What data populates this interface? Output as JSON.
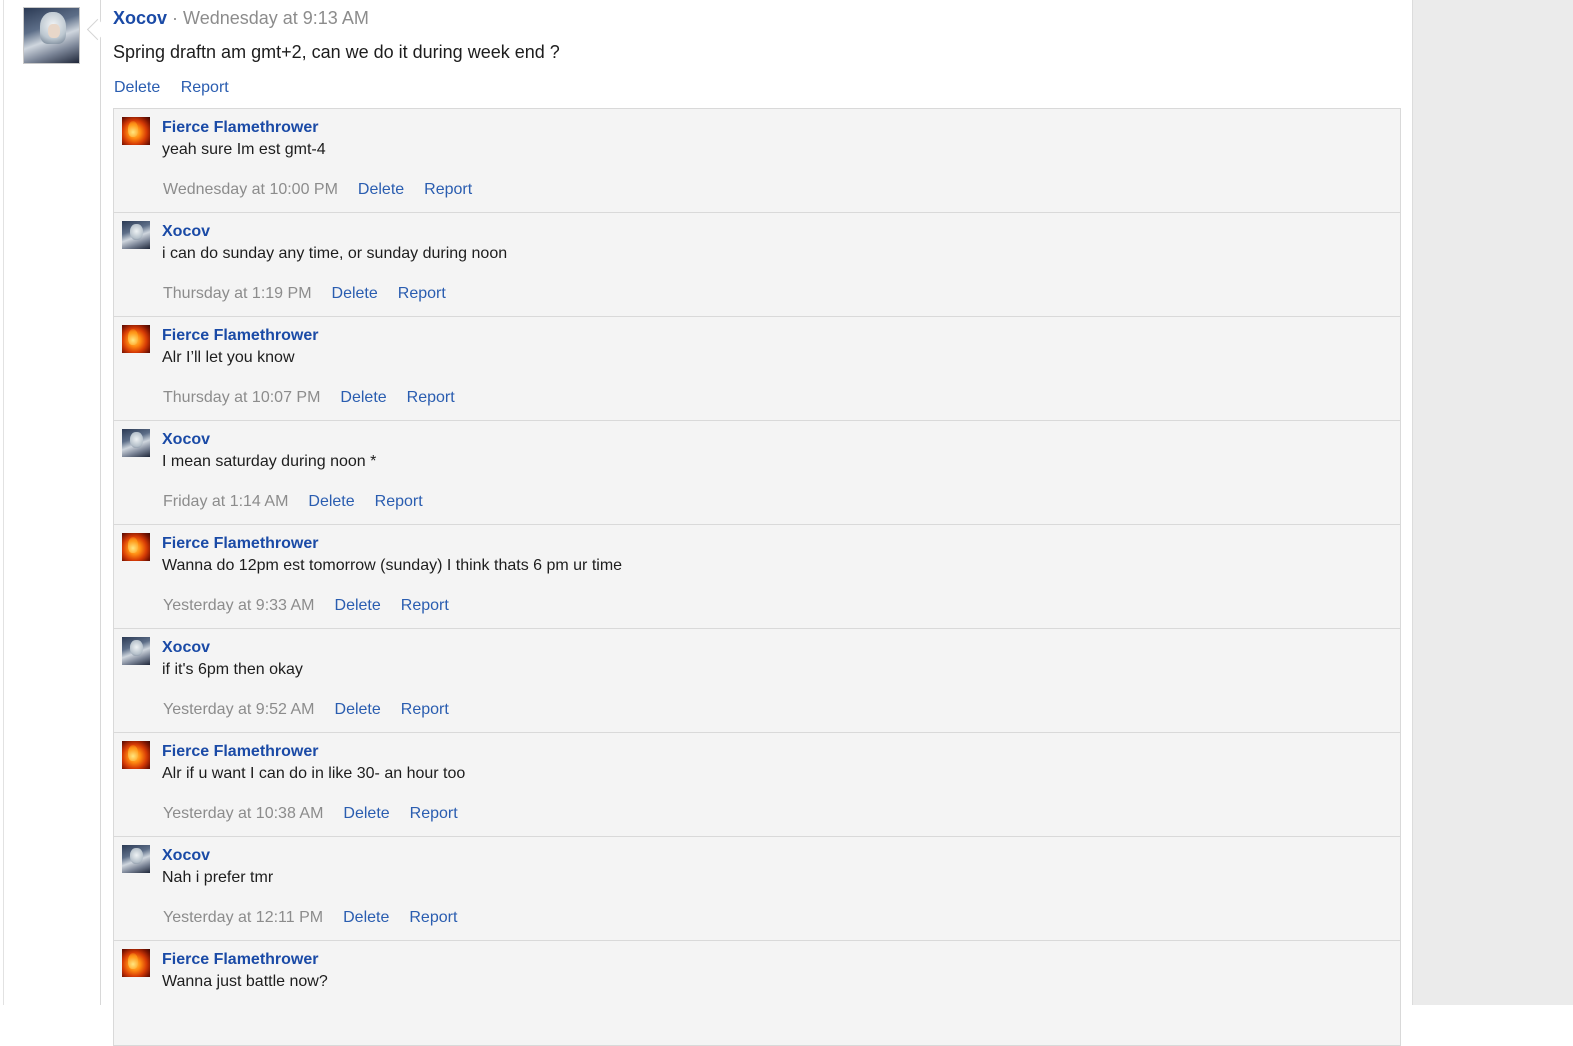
{
  "post": {
    "author": "Xocov",
    "separator": " · ",
    "time": "Wednesday at 9:13 AM",
    "text": "Spring draftn am gmt+2, can we do it during week end ?",
    "delete_label": "Delete",
    "report_label": "Report"
  },
  "comments": [
    {
      "author": "Fierce Flamethrower",
      "avatar": "fire-avatar",
      "text": "yeah sure Im est gmt-4",
      "time": "Wednesday at 10:00 PM",
      "delete_label": "Delete",
      "report_label": "Report"
    },
    {
      "author": "Xocov",
      "avatar": "xocov-avatar",
      "text": "i can do sunday any time, or sunday during noon",
      "time": "Thursday at 1:19 PM",
      "delete_label": "Delete",
      "report_label": "Report"
    },
    {
      "author": "Fierce Flamethrower",
      "avatar": "fire-avatar",
      "text": "Alr I’ll let you know",
      "time": "Thursday at 10:07 PM",
      "delete_label": "Delete",
      "report_label": "Report"
    },
    {
      "author": "Xocov",
      "avatar": "xocov-avatar",
      "text": "I mean saturday during noon *",
      "time": "Friday at 1:14 AM",
      "delete_label": "Delete",
      "report_label": "Report"
    },
    {
      "author": "Fierce Flamethrower",
      "avatar": "fire-avatar",
      "text": "Wanna do 12pm est tomorrow (sunday) I think thats 6 pm ur time",
      "time": "Yesterday at 9:33 AM",
      "delete_label": "Delete",
      "report_label": "Report"
    },
    {
      "author": "Xocov",
      "avatar": "xocov-avatar",
      "text": "if it's 6pm then okay",
      "time": "Yesterday at 9:52 AM",
      "delete_label": "Delete",
      "report_label": "Report"
    },
    {
      "author": "Fierce Flamethrower",
      "avatar": "fire-avatar",
      "text": "Alr if u want I can do in like 30- an hour too",
      "time": "Yesterday at 10:38 AM",
      "delete_label": "Delete",
      "report_label": "Report"
    },
    {
      "author": "Xocov",
      "avatar": "xocov-avatar",
      "text": "Nah i prefer tmr",
      "time": "Yesterday at 12:11 PM",
      "delete_label": "Delete",
      "report_label": "Report"
    },
    {
      "author": "Fierce Flamethrower",
      "avatar": "fire-avatar",
      "text": "Wanna just battle now?",
      "time": "",
      "delete_label": "",
      "report_label": ""
    }
  ],
  "colors": {
    "link": "#2a5db0",
    "author": "#1a4aa6",
    "muted": "#8c8c8c",
    "comment_bg": "#f4f4f4",
    "sidebar_bg": "#ebebeb"
  }
}
